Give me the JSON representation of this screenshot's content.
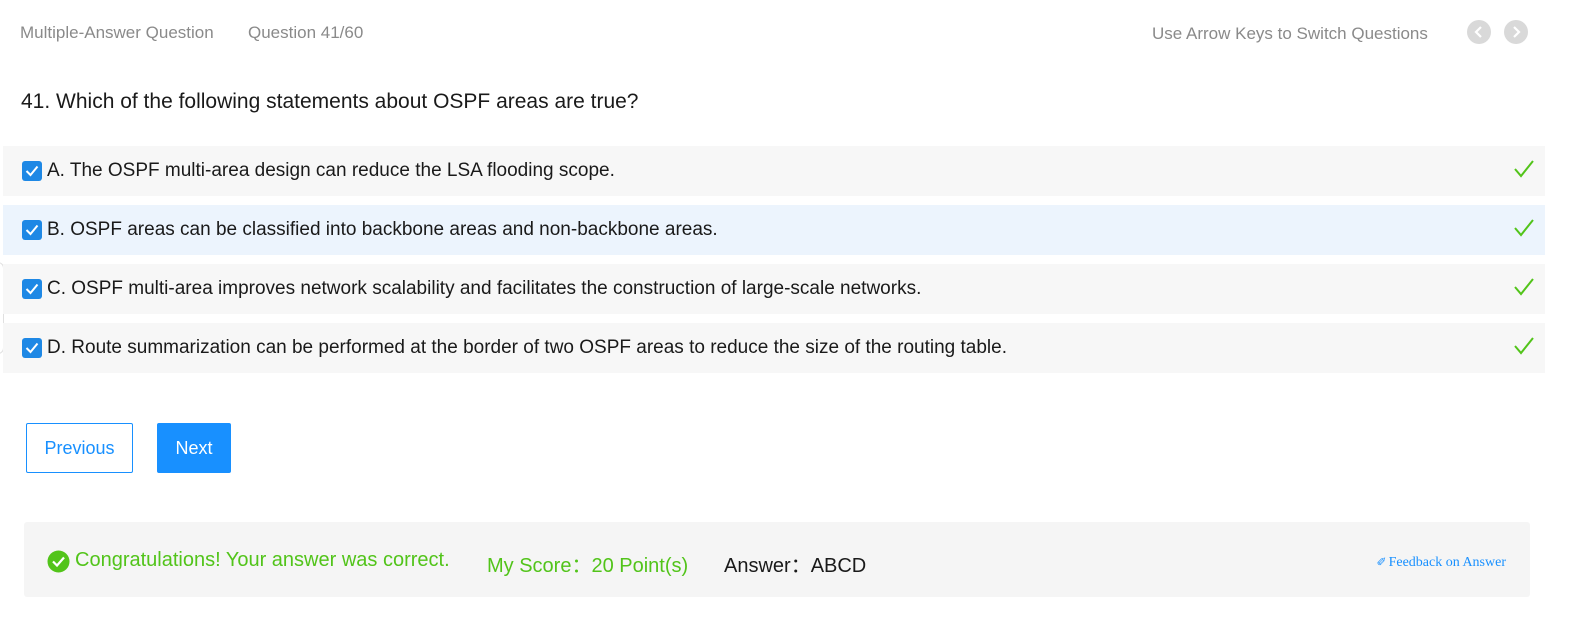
{
  "header": {
    "question_type": "Multiple-Answer Question",
    "question_counter": "Question 41/60",
    "hint": "Use Arrow Keys to Switch Questions",
    "prev_icon": "chevron-left-icon",
    "next_icon": "chevron-right-icon"
  },
  "question": {
    "text": "41. Which of the following statements about OSPF areas are true?"
  },
  "options": [
    {
      "label": "A. The OSPF multi-area design can reduce the LSA flooding scope.",
      "checked": true,
      "correct": true
    },
    {
      "label": "B. OSPF areas can be classified into backbone areas and non-backbone areas.",
      "checked": true,
      "correct": true
    },
    {
      "label": "C. OSPF multi-area improves network scalability and facilitates the construction of large-scale networks.",
      "checked": true,
      "correct": true
    },
    {
      "label": "D. Route summarization can be performed at the border of two OSPF areas to reduce the size of the routing table.",
      "checked": true,
      "correct": true
    }
  ],
  "buttons": {
    "previous": "Previous",
    "next": "Next"
  },
  "result": {
    "message": "Congratulations! Your answer was correct.",
    "score": "My Score：20 Point(s)",
    "answer": "Answer：ABCD",
    "feedback": "Feedback on Answer"
  },
  "colors": {
    "accent": "#1890ff",
    "checkbox": "#1e88e5",
    "success": "#52c41a",
    "muted_text": "#8a8a8a"
  }
}
